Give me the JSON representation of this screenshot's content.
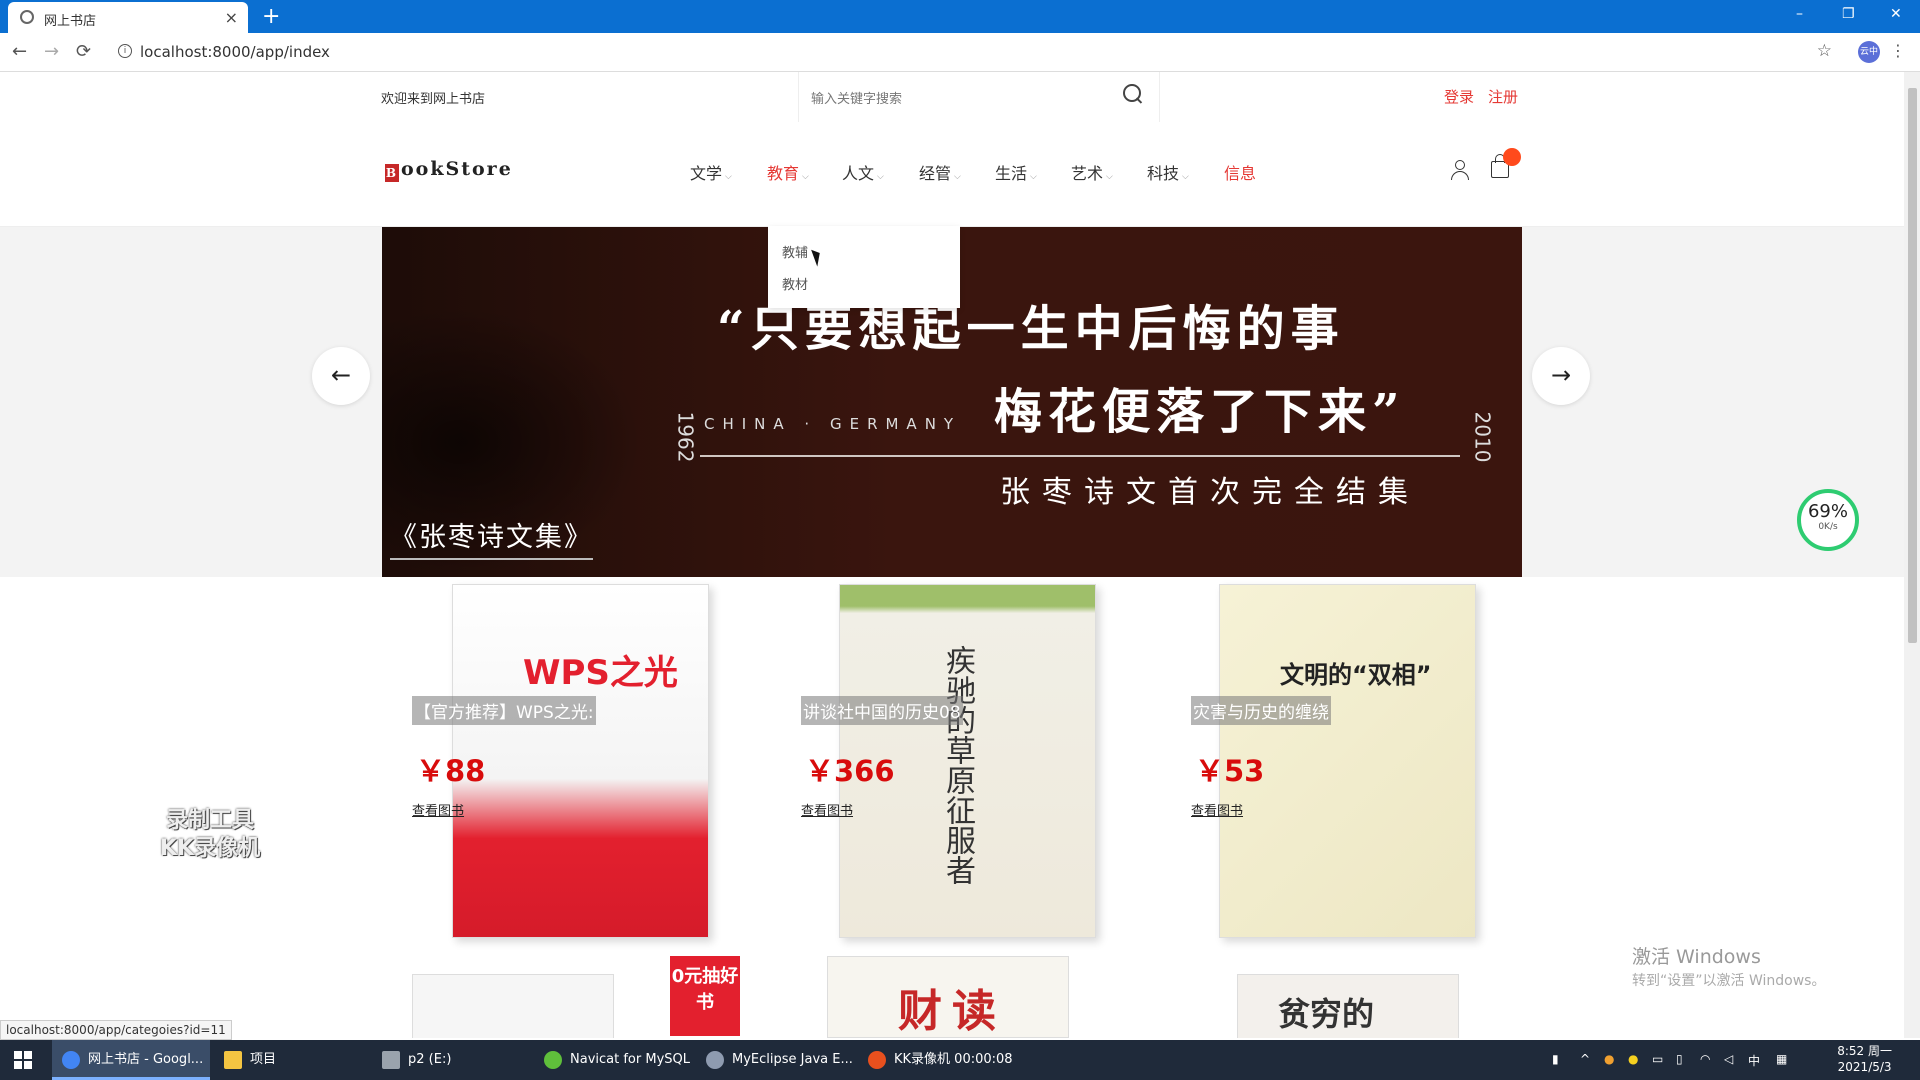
{
  "browser": {
    "tab_title": "网上书店",
    "new_tab": "+",
    "close_tab": "×",
    "window_controls": [
      "–",
      "❐",
      "✕"
    ],
    "nav_buttons": [
      "←",
      "→",
      "⟳"
    ],
    "url": "localhost:8000/app/index",
    "profile_label": "云中",
    "status_url": "localhost:8000/app/categoies?id=11"
  },
  "site": {
    "welcome": "欢迎来到网上书店",
    "search_placeholder": "输入关键字搜索",
    "login": "登录",
    "register": "注册",
    "logo_b": "B",
    "logo_rest": "ookStore",
    "nav": [
      {
        "label": "文学",
        "chev": "⌵"
      },
      {
        "label": "教育",
        "chev": "⌵"
      },
      {
        "label": "人文",
        "chev": "⌵"
      },
      {
        "label": "经管",
        "chev": "⌵"
      },
      {
        "label": "生活",
        "chev": "⌵"
      },
      {
        "label": "艺术",
        "chev": "⌵"
      },
      {
        "label": "科技",
        "chev": "⌵"
      },
      {
        "label": "信息",
        "chev": ""
      }
    ],
    "active_nav": "教育",
    "dropdown": [
      "教辅",
      "教材"
    ]
  },
  "banner": {
    "quote_line1": "“只要想起一生中后悔的事",
    "quote_line2": "梅花便落了下来”",
    "china_germany": "CHINA · GERMANY",
    "year_start": "1962",
    "year_end": "2010",
    "subtitle": "张枣诗文首次完全结集",
    "book_title": "《张枣诗文集》",
    "prev": "←",
    "next": "→"
  },
  "products": [
    {
      "name": "【官方推荐】WPS之光:",
      "price": "￥88",
      "link": "查看图书",
      "cover_text": "WPS之光"
    },
    {
      "name": "讲谈社中国的历史08",
      "price": "￥366",
      "link": "查看图书",
      "cover_text": "疾驰的草原征服者"
    },
    {
      "name": "灾害与历史的缠绕",
      "price": "￥53",
      "link": "查看图书",
      "cover_text": "文明的“双相”"
    }
  ],
  "row2": [
    {
      "cover_text": "0元抽好书"
    },
    {
      "cover_text": "财读"
    },
    {
      "cover_text": "贫穷的"
    }
  ],
  "overlays": {
    "watermark_line1": "录制工具",
    "watermark_line2": "KK录像机",
    "activate_title": "激活 Windows",
    "activate_sub": "转到“设置”以激活 Windows。",
    "speed_pct": "69%",
    "speed_rate": "0K/s"
  },
  "taskbar": {
    "items": [
      {
        "label": "网上书店 - Googl...",
        "color": "#4285f4"
      },
      {
        "label": "项目",
        "color": "#f4c542"
      },
      {
        "label": "p2 (E:)",
        "color": "#9aa3ad"
      },
      {
        "label": "Navicat for MySQL",
        "color": "#5fbf3b"
      },
      {
        "label": "MyEclipse Java E...",
        "color": "#8e9bb0"
      },
      {
        "label": "KK录像机 00:00:08",
        "color": "#e8501e"
      }
    ],
    "ime": "中",
    "time": "8:52 周一",
    "date": "2021/5/3"
  },
  "colors": {
    "accent_red": "#e53935",
    "price_red": "#d80c0c",
    "browser_blue": "#0b6fd1",
    "banner_bg": "#3a150e"
  }
}
